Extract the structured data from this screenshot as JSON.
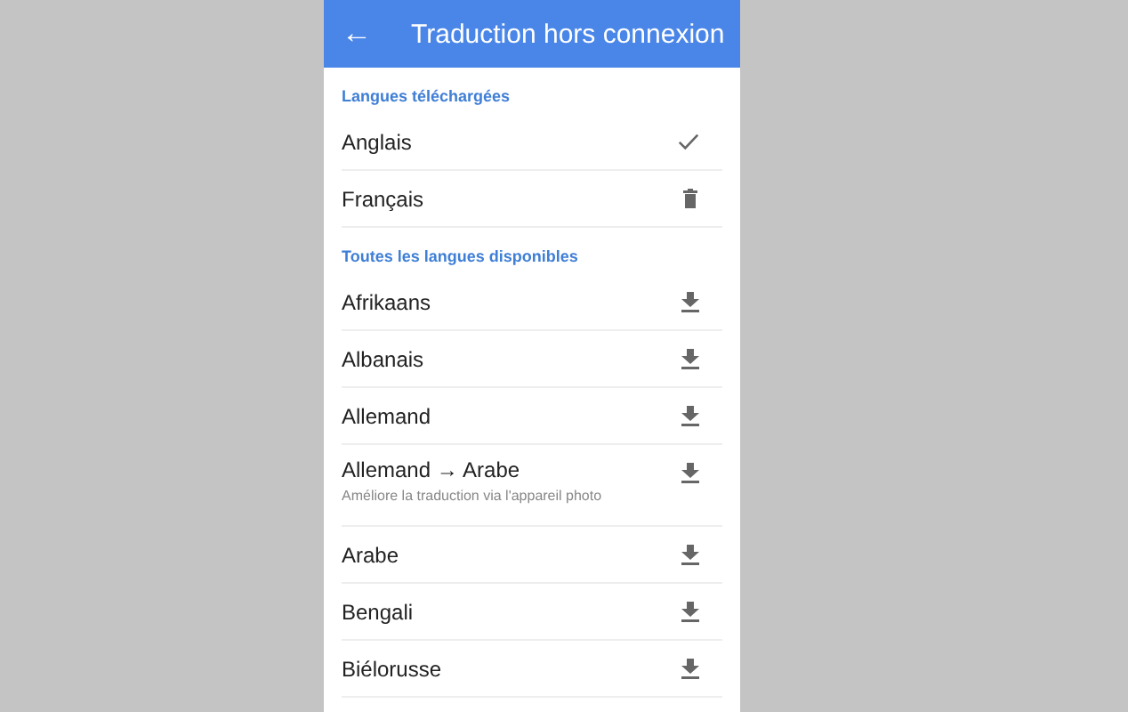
{
  "app_bar": {
    "back": "←",
    "title": "Traduction hors connexion"
  },
  "sections": [
    {
      "title": "Langues téléchargées",
      "items": [
        {
          "name": "Anglais",
          "kind": "check"
        },
        {
          "name": "Français",
          "kind": "delete"
        }
      ]
    },
    {
      "title": "Toutes les langues disponibles",
      "items": [
        {
          "name": "Afrikaans",
          "kind": "download"
        },
        {
          "name": "Albanais",
          "kind": "download"
        },
        {
          "name": "Allemand",
          "kind": "download"
        },
        {
          "name": "Allemand → Arabe",
          "subtitle": "Améliore la traduction via l'appareil photo",
          "kind": "download"
        },
        {
          "name": "Arabe",
          "kind": "download"
        },
        {
          "name": "Bengali",
          "kind": "download"
        },
        {
          "name": "Biélorusse",
          "kind": "download"
        }
      ]
    }
  ]
}
